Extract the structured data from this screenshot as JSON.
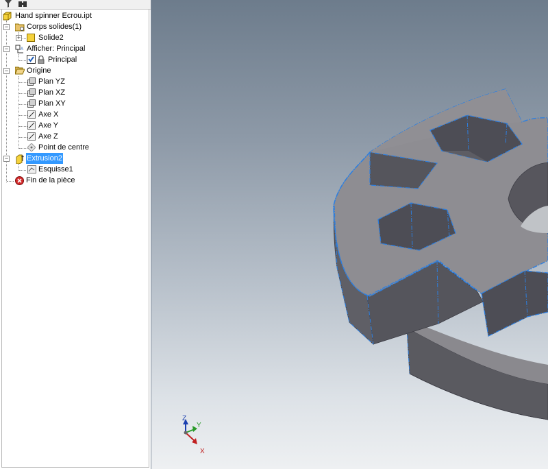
{
  "toolbar": {
    "filter_icon": "funnel-icon",
    "find_icon": "binoculars-icon"
  },
  "tree": {
    "root": "Hand spinner Ecrou.ipt",
    "solid_bodies": "Corps solides(1)",
    "solid": "Solide2",
    "view": "Afficher: Principal",
    "view_primary": "Principal",
    "origin": "Origine",
    "plane_yz": "Plan YZ",
    "plane_xz": "Plan XZ",
    "plane_xy": "Plan XY",
    "axis_x": "Axe X",
    "axis_y": "Axe Y",
    "axis_z": "Axe Z",
    "center_point": "Point de centre",
    "extrusion": "Extrusion2",
    "sketch": "Esquisse1",
    "end_of_part": "Fin de la pièce"
  },
  "triad": {
    "x": "X",
    "y": "Y",
    "z": "Z"
  },
  "colors": {
    "selection": "#3399ff",
    "part_face": "#8e8d92",
    "part_side": "#5c5c64",
    "edge_highlight": "#1e90ff"
  }
}
